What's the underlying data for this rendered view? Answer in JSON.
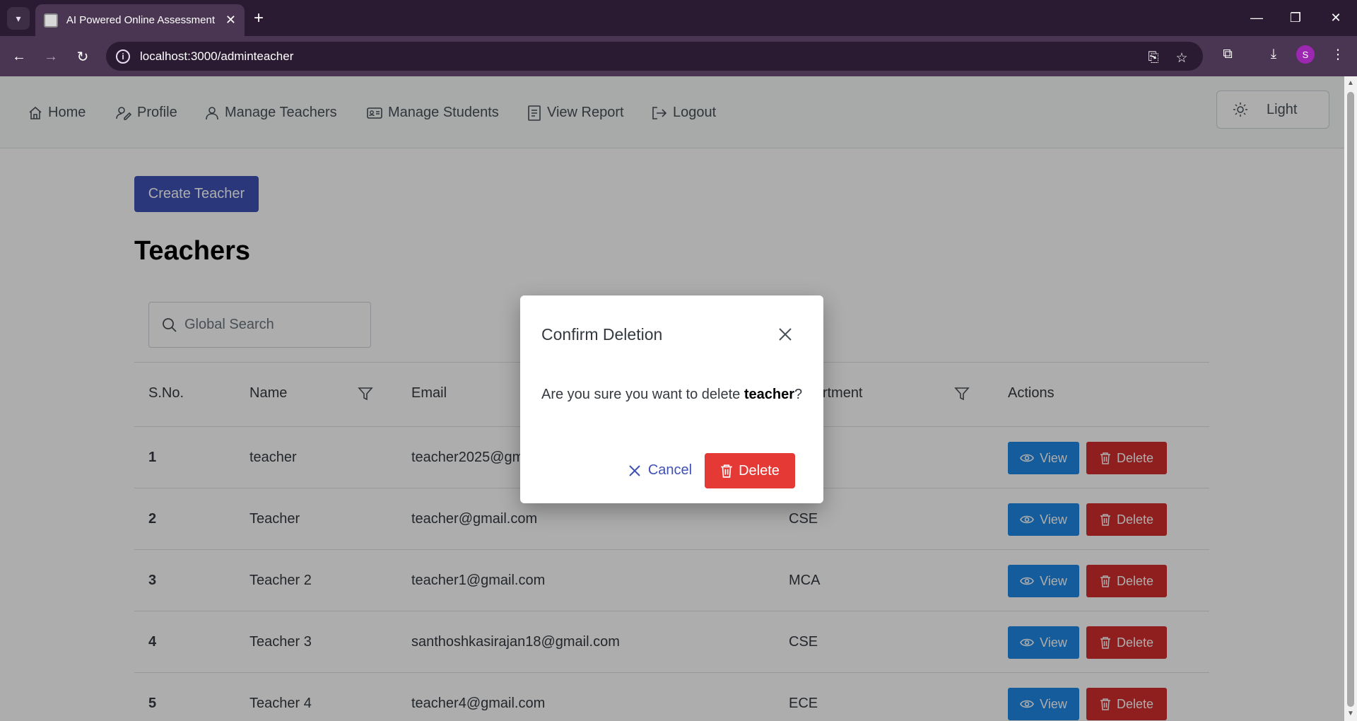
{
  "browser": {
    "tab_title": "AI Powered Online Assessment",
    "url": "localhost:3000/adminteacher",
    "avatar_letter": "S"
  },
  "nav": {
    "items": [
      {
        "label": "Home",
        "icon": "home-icon"
      },
      {
        "label": "Profile",
        "icon": "profile-edit-icon"
      },
      {
        "label": "Manage Teachers",
        "icon": "user-icon"
      },
      {
        "label": "Manage Students",
        "icon": "id-card-icon"
      },
      {
        "label": "View Report",
        "icon": "document-icon"
      },
      {
        "label": "Logout",
        "icon": "logout-icon"
      }
    ],
    "theme_label": "Light"
  },
  "page": {
    "create_button": "Create Teacher",
    "heading": "Teachers",
    "search_placeholder": "Global Search"
  },
  "table": {
    "headers": {
      "sno": "S.No.",
      "name": "Name",
      "email": "Email",
      "department": "Department",
      "actions": "Actions"
    },
    "view_label": "View",
    "delete_label": "Delete",
    "rows": [
      {
        "sno": "1",
        "name": "teacher",
        "email": "teacher2025@gmail.com",
        "department": ""
      },
      {
        "sno": "2",
        "name": "Teacher",
        "email": "teacher@gmail.com",
        "department": "CSE"
      },
      {
        "sno": "3",
        "name": "Teacher 2",
        "email": "teacher1@gmail.com",
        "department": "MCA"
      },
      {
        "sno": "4",
        "name": "Teacher 3",
        "email": "santhoshkasirajan18@gmail.com",
        "department": "CSE"
      },
      {
        "sno": "5",
        "name": "Teacher 4",
        "email": "teacher4@gmail.com",
        "department": "ECE"
      }
    ]
  },
  "dialog": {
    "title": "Confirm Deletion",
    "message_prefix": "Are you sure you want to delete ",
    "message_target": "teacher",
    "message_suffix": "?",
    "cancel_label": "Cancel",
    "delete_label": "Delete"
  },
  "colors": {
    "primary": "#3f51b5",
    "view": "#1e88e5",
    "delete": "#d32f2f",
    "dialog_delete": "#e53935",
    "browser_chrome": "#4a3652"
  }
}
